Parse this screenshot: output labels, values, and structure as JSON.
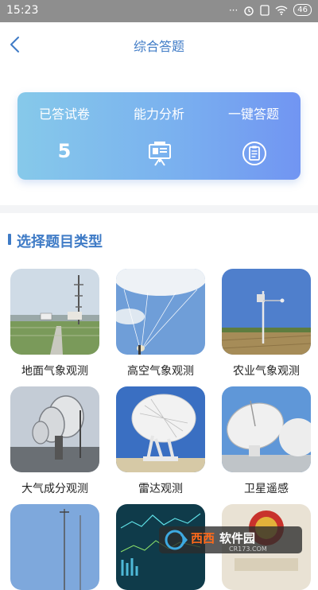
{
  "status_bar": {
    "time": "15:23",
    "battery": "46"
  },
  "header": {
    "title": "综合答题"
  },
  "stats": [
    {
      "label": "已答试卷",
      "value": "5"
    },
    {
      "label": "能力分析",
      "icon": "presentation-board-icon"
    },
    {
      "label": "一键答题",
      "icon": "clipboard-list-icon"
    }
  ],
  "section": {
    "title": "选择题目类型"
  },
  "categories": [
    {
      "label": "地面气象观测"
    },
    {
      "label": "高空气象观测"
    },
    {
      "label": "农业气象观测"
    },
    {
      "label": "大气成分观测"
    },
    {
      "label": "雷达观测"
    },
    {
      "label": "卫星遥感"
    },
    {
      "label": ""
    },
    {
      "label": ""
    },
    {
      "label": ""
    }
  ],
  "watermark": {
    "text": "西西软件园",
    "sub": "CR173.COM"
  },
  "colors": {
    "accent": "#3f7bc6",
    "card_start": "#86c9ea",
    "card_end": "#7195f2"
  }
}
